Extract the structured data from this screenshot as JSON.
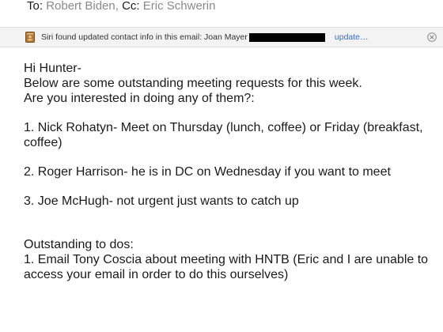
{
  "header": {
    "to_label": "To:",
    "to_name": "Robert Biden,",
    "cc_label": "Cc:",
    "cc_name": "Eric Schwerin"
  },
  "siri_banner": {
    "text": "Siri found updated contact info in this email: Joan Mayer",
    "update_label": "update…",
    "icon": "contact-card-icon",
    "close_icon": "close-circle-icon"
  },
  "message": {
    "greeting": "Hi Hunter-",
    "line1": "Below are some outstanding meeting requests for this week.",
    "line2": "Are you interested in doing any of them?:",
    "item1": "1. Nick Rohatyn- Meet on Thursday (lunch, coffee) or Friday (breakfast, coffee)",
    "item2": "2. Roger Harrison- he is in DC on Wednesday if you want to meet",
    "item3": "3. Joe McHugh- not urgent just wants to catch up",
    "todos_heading": "Outstanding to dos:",
    "todo1": "1. Email Tony Coscia about meeting with HNTB  (Eric and I are unable to access your email in order to do this ourselves)"
  }
}
